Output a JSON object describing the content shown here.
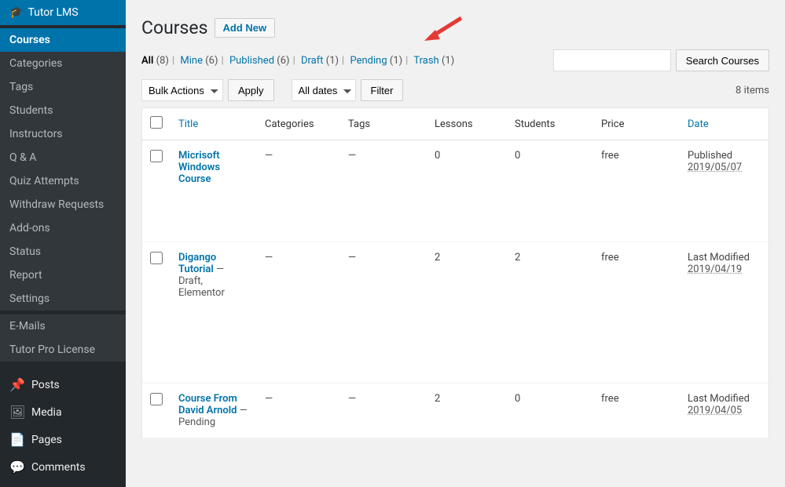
{
  "brand": "Tutor LMS",
  "sidebar": {
    "items": [
      {
        "label": "Courses",
        "active": true
      },
      {
        "label": "Categories"
      },
      {
        "label": "Tags"
      },
      {
        "label": "Students"
      },
      {
        "label": "Instructors"
      },
      {
        "label": "Q & A"
      },
      {
        "label": "Quiz Attempts"
      },
      {
        "label": "Withdraw Requests"
      },
      {
        "label": "Add-ons"
      },
      {
        "label": "Status"
      },
      {
        "label": "Report"
      },
      {
        "label": "Settings"
      },
      {
        "label": "E-Mails",
        "gap": true
      },
      {
        "label": "Tutor Pro License"
      }
    ],
    "main": [
      {
        "icon": "📌",
        "label": "Posts"
      },
      {
        "icon": "🖼",
        "label": "Media"
      },
      {
        "icon": "📄",
        "label": "Pages"
      },
      {
        "icon": "💬",
        "label": "Comments"
      }
    ]
  },
  "page": {
    "title": "Courses",
    "add_new": "Add New"
  },
  "status_links": [
    {
      "label": "All",
      "count": "(8)",
      "current": true
    },
    {
      "label": "Mine",
      "count": "(6)"
    },
    {
      "label": "Published",
      "count": "(6)"
    },
    {
      "label": "Draft",
      "count": "(1)"
    },
    {
      "label": "Pending",
      "count": "(1)"
    },
    {
      "label": "Trash",
      "count": "(1)"
    }
  ],
  "search": {
    "placeholder": "",
    "button": "Search Courses"
  },
  "bulk": {
    "label": "Bulk Actions",
    "apply": "Apply"
  },
  "dates": {
    "label": "All dates",
    "filter": "Filter"
  },
  "items_count": "8 items",
  "columns": {
    "title": "Title",
    "categories": "Categories",
    "tags": "Tags",
    "lessons": "Lessons",
    "students": "Students",
    "price": "Price",
    "date": "Date"
  },
  "rows": [
    {
      "title": "Micrisoft Windows Course",
      "state": "",
      "categories": "—",
      "tags": "—",
      "lessons": "0",
      "students": "0",
      "price": "free",
      "date_label": "Published",
      "date": "2019/05/07"
    },
    {
      "title": "Digango Tutorial",
      "state": " — Draft, Elementor",
      "categories": "—",
      "tags": "—",
      "lessons": "2",
      "students": "2",
      "price": "free",
      "date_label": "Last Modified",
      "date": "2019/04/19"
    },
    {
      "title": "Course From David Arnold",
      "state": " — Pending",
      "categories": "—",
      "tags": "—",
      "lessons": "2",
      "students": "0",
      "price": "free",
      "date_label": "Last Modified",
      "date": "2019/04/05"
    }
  ]
}
